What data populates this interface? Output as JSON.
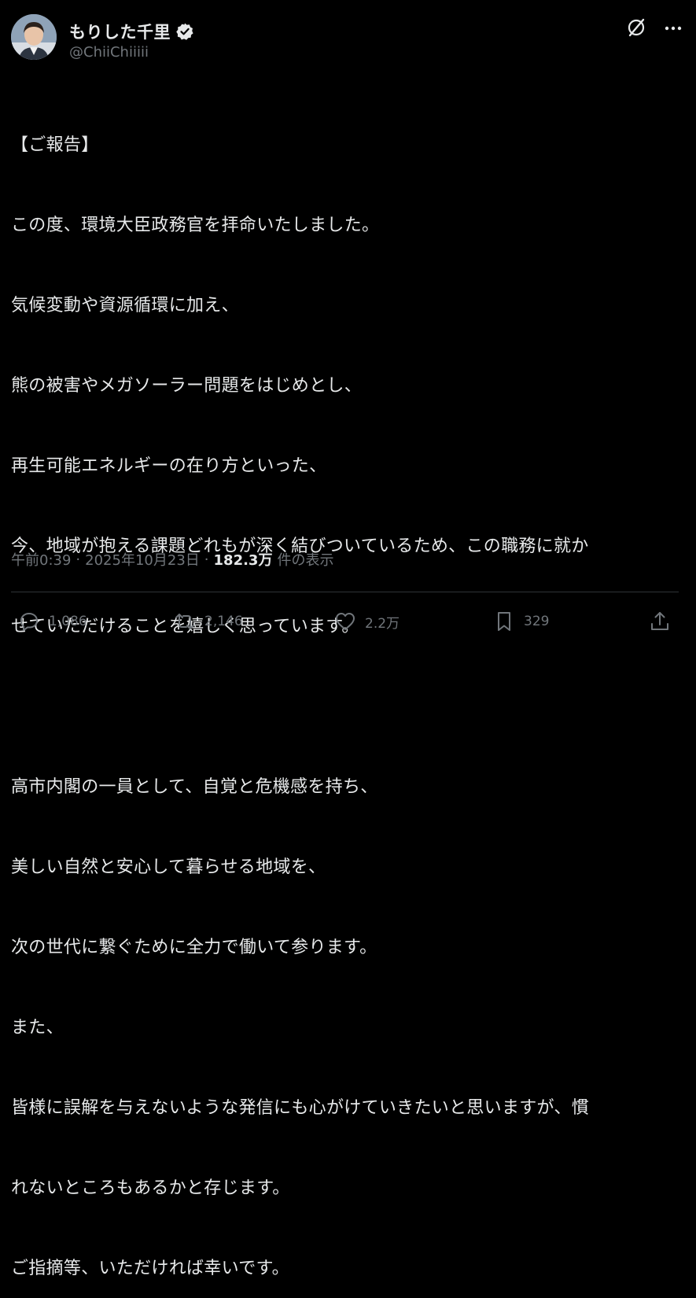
{
  "user": {
    "display_name": "もりした千里",
    "handle": "@ChiiChiiiii",
    "verified_icon": "verified-badge-icon",
    "badge_color": "#e7e9ea"
  },
  "header_actions": {
    "grok_icon": "grok-icon",
    "more_icon": "more-horizontal-icon"
  },
  "post": {
    "lines": [
      "【ご報告】",
      "この度、環境大臣政務官を拝命いたしました。",
      "気候変動や資源循環に加え、",
      "熊の被害やメガソーラー問題をはじめとし、",
      "再生可能エネルギーの在り方といった、",
      "今、地域が抱える課題どれもが深く結びついているため、この職務に就か",
      "せていただけることを嬉しく思っています。",
      "",
      "高市内閣の一員として、自覚と危機感を持ち、",
      "美しい自然と安心して暮らせる地域を、",
      "次の世代に繋ぐために全力で働いて参ります。",
      "また、",
      "皆様に誤解を与えないような発信にも心がけていきたいと思いますが、慣",
      "れないところもあるかと存じます。",
      "ご指摘等、いただければ幸いです。"
    ]
  },
  "meta": {
    "time": "午前0:39",
    "separator": "·",
    "date": "2025年10月23日",
    "views_count": "182.3万",
    "views_label": "件の表示"
  },
  "actions": {
    "replies": "1,086",
    "reposts": "2,146",
    "likes": "2.2万",
    "bookmarks": "329"
  },
  "colors": {
    "background": "#000000",
    "text": "#e7e9ea",
    "muted": "#71767b",
    "divider": "#2f3336"
  }
}
